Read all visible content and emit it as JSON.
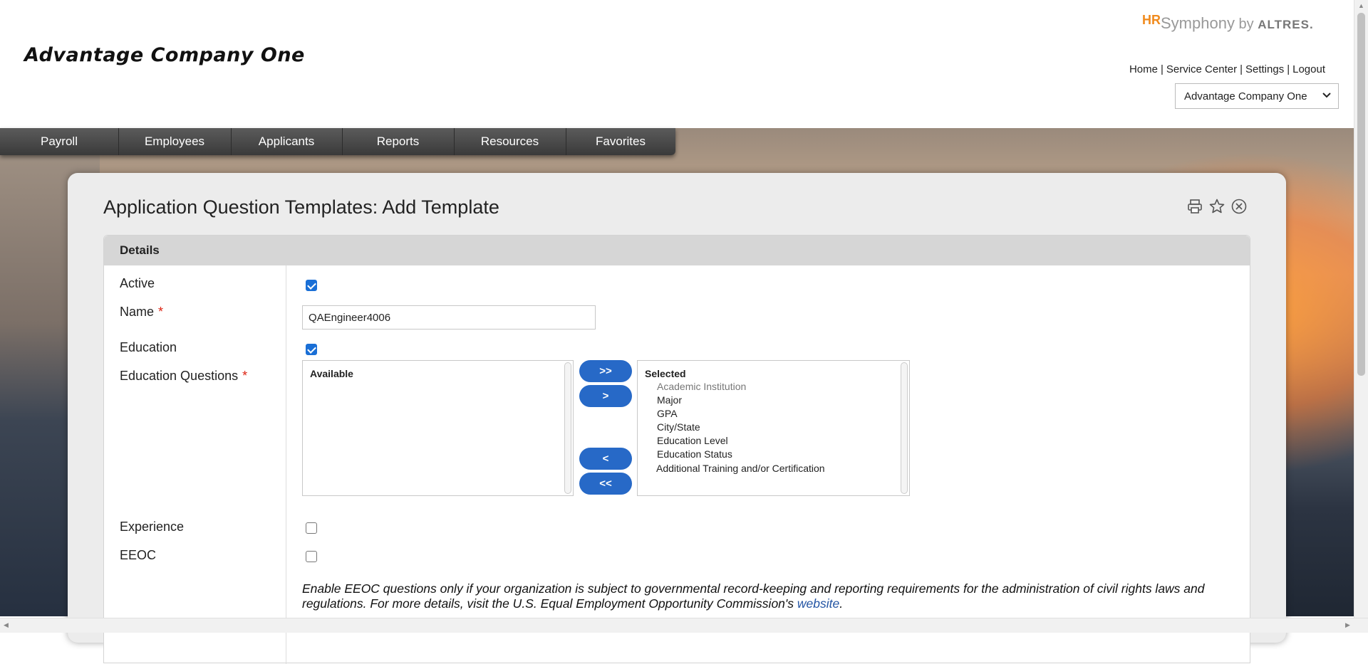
{
  "header": {
    "company_title": "Advantage Company One",
    "brand": {
      "hr": "HR",
      "symphony": "Symphony",
      "by": " by ",
      "altres": "ALTRES."
    },
    "links": [
      "Home",
      "Service Center",
      "Settings",
      "Logout"
    ],
    "company_select_value": "Advantage Company One"
  },
  "nav": {
    "items": [
      "Payroll",
      "Employees",
      "Applicants",
      "Reports",
      "Resources",
      "Favorites"
    ]
  },
  "page": {
    "title": "Application Question Templates: Add Template",
    "tools": [
      "printer-icon",
      "star-icon",
      "close-circle-icon"
    ]
  },
  "details": {
    "section_title": "Details",
    "active_label": "Active",
    "active_checked": true,
    "name_label": "Name",
    "required_mark": "*",
    "name_value": "QAEngineer4006",
    "education_label": "Education",
    "education_checked": true,
    "education_questions_label": "Education Questions",
    "available_title": "Available",
    "selected_title": "Selected",
    "selected_items": [
      "Academic Institution",
      "Major",
      "GPA",
      "City/State",
      "Education Level",
      "Education Status",
      "Additional Training and/or Certification"
    ],
    "buttons": {
      "add_all": ">>",
      "add": ">",
      "remove": "<",
      "remove_all": "<<"
    },
    "experience_label": "Experience",
    "experience_checked": false,
    "eeoc_label": "EEOC",
    "eeoc_checked": false,
    "eeoc_note_text": "Enable EEOC questions only if your organization is subject to governmental record-keeping and reporting requirements for the administration of civil rights laws and regulations. For more details, visit the U.S. Equal Employment Opportunity Commission's ",
    "eeoc_link": "website",
    "eeoc_end": "."
  },
  "colors": {
    "accent": "#2769c7",
    "brand_orange": "#f08a1c",
    "required": "#dd2211"
  }
}
